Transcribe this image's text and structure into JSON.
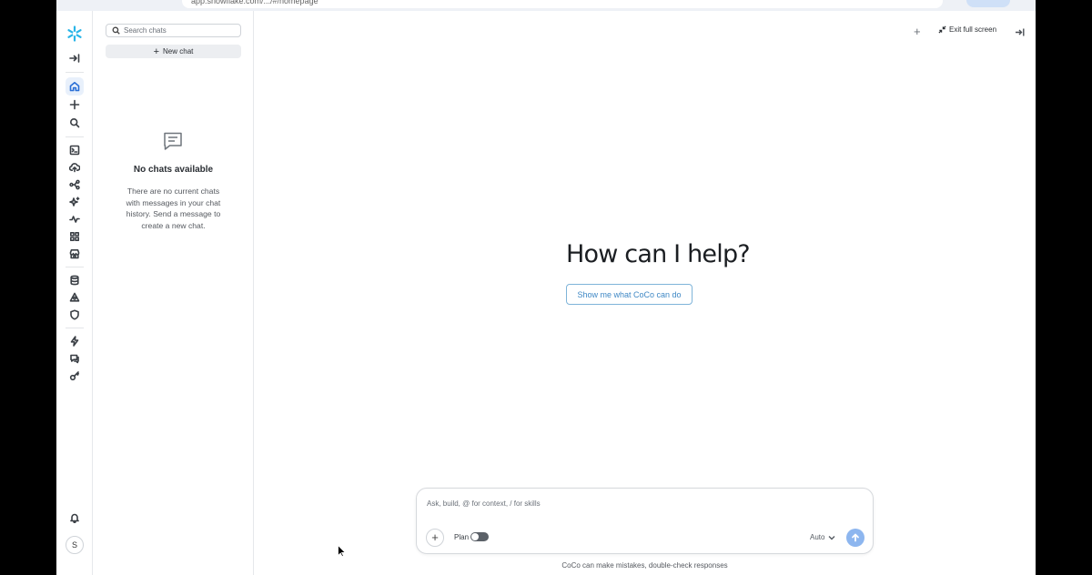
{
  "browser": {
    "url": "app.snowflake.com/.../#/homepage"
  },
  "rail": {
    "items": [
      {
        "icon": "collapse-sidebar-icon"
      },
      {
        "icon": "home-icon",
        "active": true
      },
      {
        "icon": "plus-icon"
      },
      {
        "icon": "search-icon"
      },
      {
        "icon": "worksheet-icon"
      },
      {
        "icon": "cloud-upload-icon"
      },
      {
        "icon": "workflow-icon"
      },
      {
        "icon": "ai-sparkle-icon"
      },
      {
        "icon": "activity-icon"
      },
      {
        "icon": "apps-grid-icon"
      },
      {
        "icon": "marketplace-icon"
      },
      {
        "icon": "database-icon"
      },
      {
        "icon": "data-sharing-icon"
      },
      {
        "icon": "shield-icon"
      },
      {
        "icon": "lightning-icon"
      },
      {
        "icon": "chat-bubble-icon"
      },
      {
        "icon": "admin-key-icon"
      },
      {
        "icon": "bell-icon"
      }
    ],
    "avatar_initial": "S",
    "accent_color": "#2a6fd6"
  },
  "chats": {
    "search_placeholder": "Search chats",
    "new_chat_label": "New chat",
    "empty_title": "No chats available",
    "empty_body": "There are no current chats with messages in your chat history. Send a message to create a new chat."
  },
  "header": {
    "exit_fullscreen_label": "Exit full screen"
  },
  "main": {
    "headline": "How can I help?",
    "show_button_label": "Show me what CoCo can do"
  },
  "composer": {
    "placeholder": "Ask, build, @ for context, / for skills",
    "plan_label": "Plan",
    "plan_enabled": false,
    "model_label": "Auto",
    "disclaimer": "CoCo can make mistakes, double-check responses"
  }
}
